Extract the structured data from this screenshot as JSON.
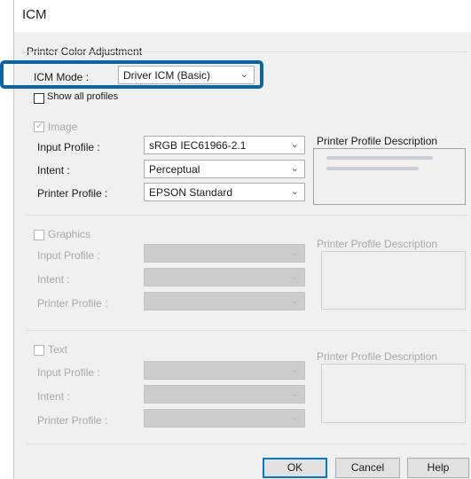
{
  "window": {
    "title": "ICM"
  },
  "adjustment": {
    "label": "Printer Color Adjustment",
    "icm_mode_label": "ICM Mode :",
    "icm_mode_value": "Driver ICM (Basic)",
    "show_all_profiles": "Show all profiles"
  },
  "image": {
    "label": "Image",
    "input_profile_label": "Input Profile :",
    "input_profile_value": "sRGB IEC61966-2.1",
    "intent_label": "Intent :",
    "intent_value": "Perceptual",
    "printer_profile_label": "Printer Profile :",
    "printer_profile_value": "EPSON Standard",
    "description_label": "Printer Profile Description"
  },
  "graphics": {
    "label": "Graphics",
    "input_profile_label": "Input Profile :",
    "intent_label": "Intent :",
    "printer_profile_label": "Printer Profile :",
    "description_label": "Printer Profile Description"
  },
  "text": {
    "label": "Text",
    "input_profile_label": "Input Profile :",
    "intent_label": "Intent :",
    "printer_profile_label": "Printer Profile :",
    "description_label": "Printer Profile Description"
  },
  "buttons": {
    "ok": "OK",
    "cancel": "Cancel",
    "help": "Help"
  },
  "icons": {
    "dropdown": "chevron-down-icon",
    "checkbox": "checkbox-icon"
  },
  "colors": {
    "highlight": "#0a64a6",
    "default_button_border": "#0078d7"
  }
}
